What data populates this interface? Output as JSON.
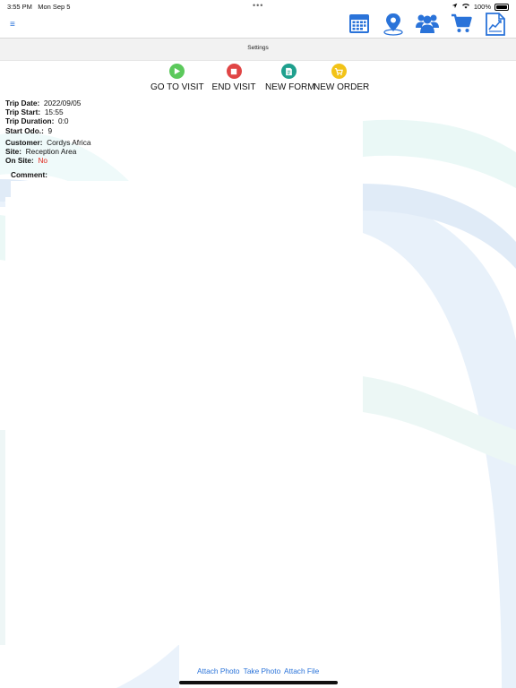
{
  "status_bar": {
    "time": "3:55 PM",
    "date": "Mon Sep 5",
    "dots": "•••",
    "battery": "100%"
  },
  "nav": {
    "menu_icon": "≡",
    "icons": [
      "calendar-icon",
      "map-pin-icon",
      "users-icon",
      "cart-icon",
      "report-icon"
    ],
    "accent": "#2a73d9"
  },
  "settings_bar": {
    "title": "Settings"
  },
  "actions": [
    {
      "label": "GO TO VISIT",
      "icon": "play-icon",
      "color": "#5cc95c"
    },
    {
      "label": "END VISIT",
      "icon": "stop-icon",
      "color": "#e04545"
    },
    {
      "label": "NEW FORM",
      "icon": "form-icon",
      "color": "#1fa08e"
    },
    {
      "label": "NEW ORDER",
      "icon": "order-icon",
      "color": "#f2c318"
    }
  ],
  "trip": {
    "date_label": "Trip Date:",
    "date": "2022/09/05",
    "start_label": "Trip Start:",
    "start": "15:55",
    "duration_label": "Trip Duration:",
    "duration": "0:0",
    "odo_label": "Start Odo.:",
    "odo": "9"
  },
  "site_info": {
    "customer_label": "Customer:",
    "customer": "Cordys Africa",
    "site_label": "Site:",
    "site": "Reception Area",
    "onsite_label": "On Site:",
    "onsite": "No"
  },
  "comment": {
    "label": "Comment:",
    "value": ""
  },
  "bottom_links": {
    "attach_photo": "Attach Photo",
    "take_photo": "Take Photo",
    "attach_file": "Attach File"
  }
}
